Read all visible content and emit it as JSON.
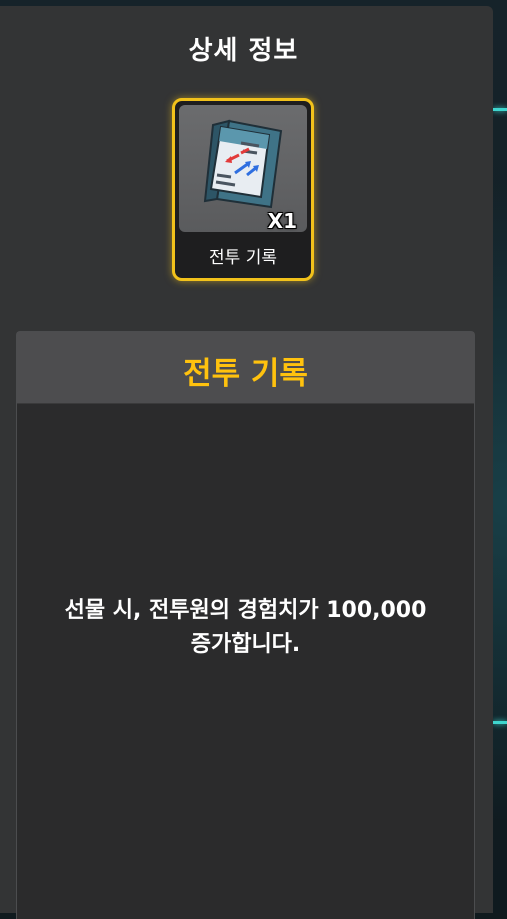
{
  "panel": {
    "title": "상세 정보"
  },
  "item": {
    "name": "전투 기록",
    "quantity": "X1",
    "icon": "battle-record-book-icon"
  },
  "description": {
    "title": "전투 기록",
    "text": "선물 시, 전투원의 경험치가 100,000\n증가합니다."
  },
  "colors": {
    "accent": "#ffc20e",
    "card_border": "#f2c21b",
    "panel_bg": "#333435",
    "glow": "#3fd6cf"
  }
}
